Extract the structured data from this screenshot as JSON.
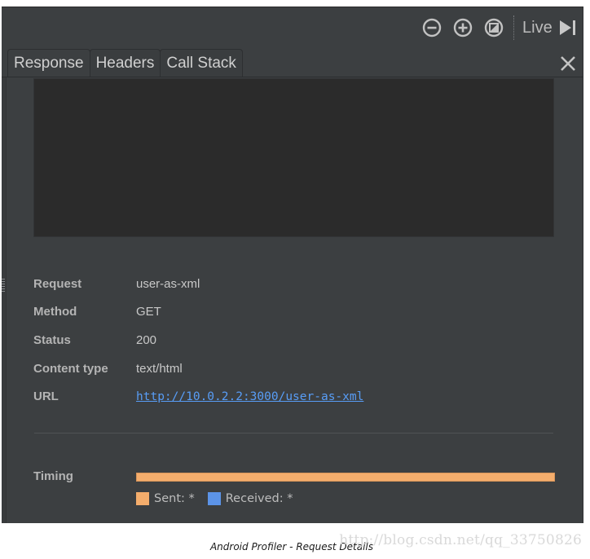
{
  "toolbar": {
    "icons": [
      "zoom-out-icon",
      "zoom-in-icon",
      "reset-zoom-icon"
    ],
    "live_label": "Live",
    "live_icon": "jump-to-end-icon"
  },
  "tabs": [
    {
      "label": "Response",
      "active": true
    },
    {
      "label": "Headers",
      "active": false
    },
    {
      "label": "Call Stack",
      "active": false
    }
  ],
  "close_icon": "close-icon",
  "details": {
    "request": {
      "label": "Request",
      "value": "user-as-xml"
    },
    "method": {
      "label": "Method",
      "value": "GET"
    },
    "status": {
      "label": "Status",
      "value": "200"
    },
    "content_type": {
      "label": "Content type",
      "value": "text/html"
    },
    "url": {
      "label": "URL",
      "value": "http://10.0.2.2:3000/user-as-xml"
    }
  },
  "timing": {
    "label": "Timing",
    "sent_fraction": 1.0,
    "legend": [
      {
        "label": "Sent: *",
        "color": "#f4ad6c"
      },
      {
        "label": "Received: *",
        "color": "#5c94e8"
      }
    ]
  },
  "caption": "Android Profiler - Request Details",
  "watermark": "http://blog.csdn.net/qq_33750826",
  "colors": {
    "panel_bg": "#3c3f41",
    "preview_bg": "#2b2b2b",
    "link": "#589df6",
    "sent": "#f4ad6c",
    "received": "#5c94e8"
  }
}
